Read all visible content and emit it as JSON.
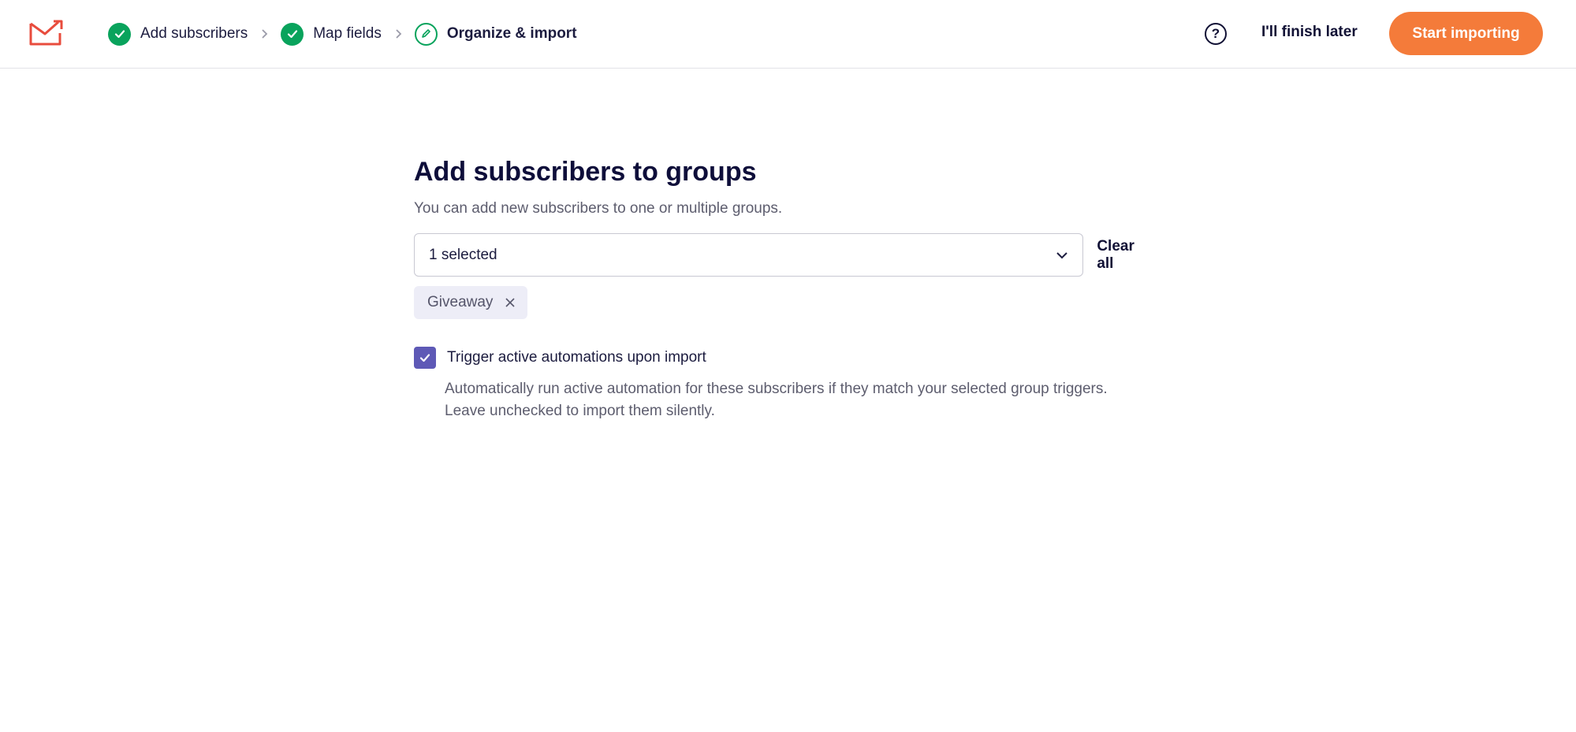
{
  "header": {
    "logo_icon": "mail-send-icon",
    "steps": [
      {
        "label": "Add subscribers",
        "status": "complete",
        "icon": "check-icon"
      },
      {
        "label": "Map fields",
        "status": "complete",
        "icon": "check-icon"
      },
      {
        "label": "Organize & import",
        "status": "current",
        "icon": "pencil-icon"
      }
    ],
    "help_icon": "question-circle-icon",
    "finish_later_label": "I'll finish later",
    "start_importing_label": "Start importing"
  },
  "main": {
    "title": "Add subscribers to groups",
    "subtitle": "You can add new subscribers to one or multiple groups.",
    "group_select": {
      "value": "1 selected",
      "icon": "chevron-down-icon"
    },
    "clear_all_label": "Clear all",
    "selected_groups": [
      {
        "label": "Giveaway",
        "remove_icon": "close-icon"
      }
    ],
    "trigger_automations": {
      "checked": true,
      "label": "Trigger active automations upon import",
      "help_line_1": "Automatically run active automation for these subscribers if they match your selected group triggers.",
      "help_line_2": "Leave unchecked to import them silently."
    }
  },
  "colors": {
    "accent_orange": "#f47b3a",
    "success_green": "#09a35c",
    "checkbox_purple": "#5e59b6",
    "tag_bg": "#ededf7",
    "heading": "#0e0e3a"
  }
}
